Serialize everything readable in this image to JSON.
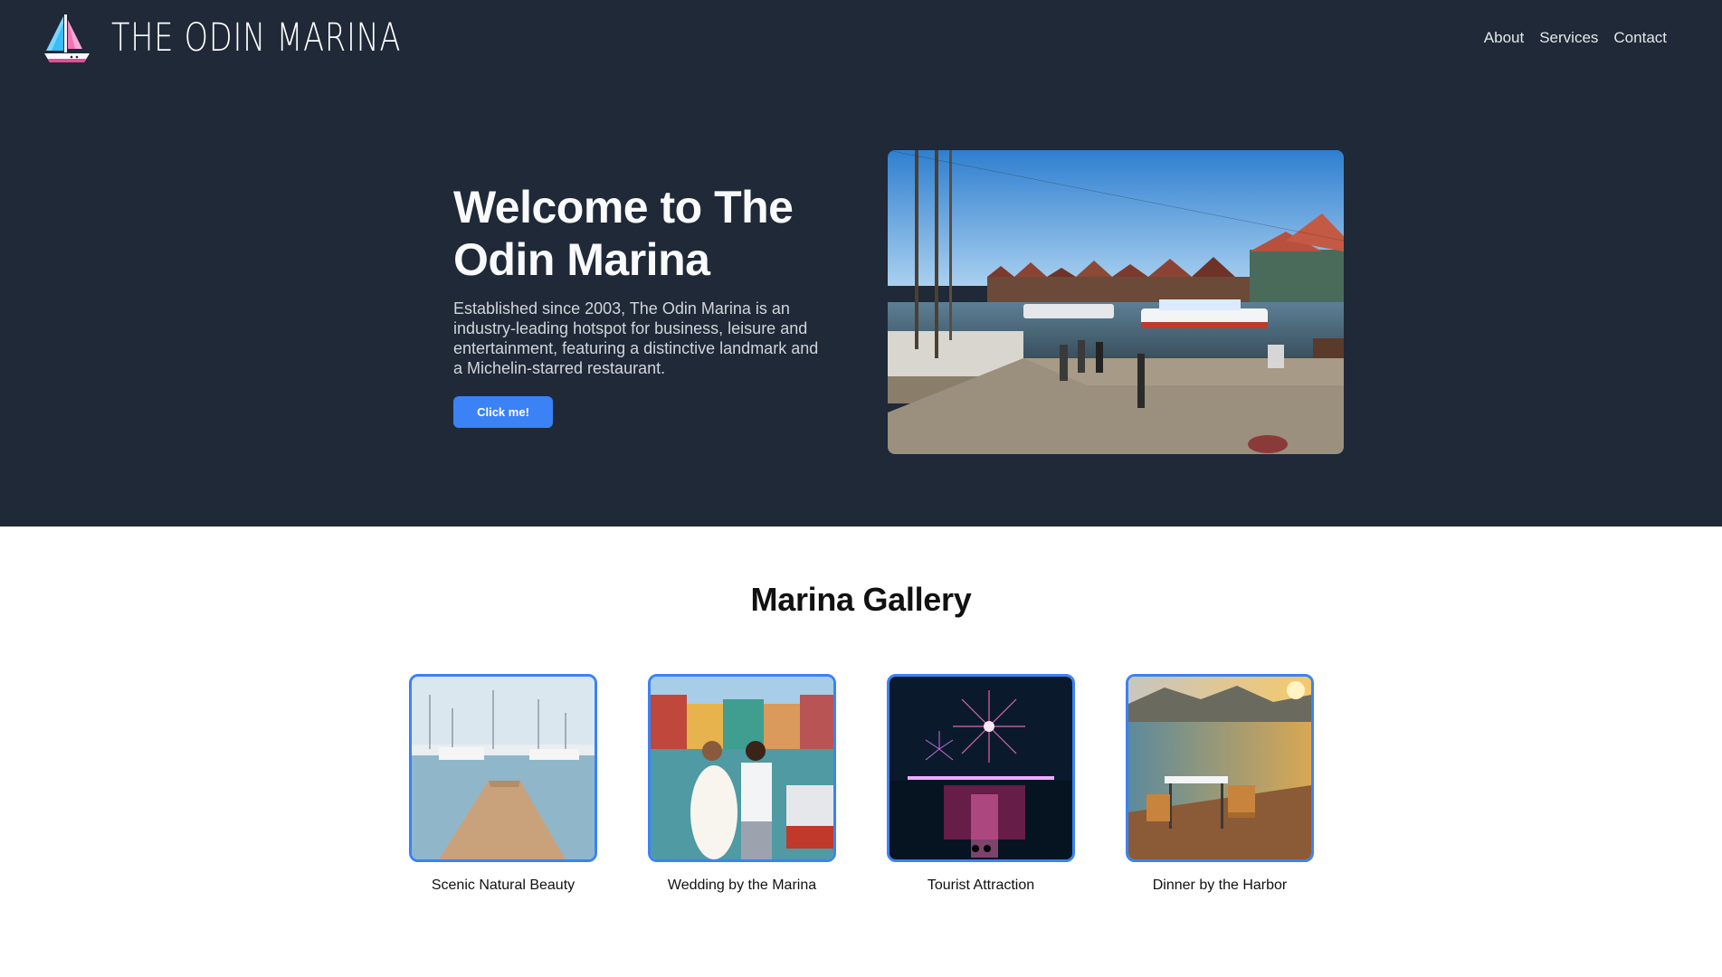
{
  "brand": {
    "name": "THE ODIN MARINA",
    "logo_icon": "sailboat-icon"
  },
  "nav": {
    "items": [
      {
        "label": "About"
      },
      {
        "label": "Services"
      },
      {
        "label": "Contact"
      }
    ]
  },
  "hero": {
    "title": "Welcome to The Odin Marina",
    "description": "Established since 2003, The Odin Marina is an industry-leading hotspot for business, leisure and entertainment, featuring a distinctive landmark and a Michelin-starred restaurant.",
    "button_label": "Click me!",
    "image_alt": "Harbor with boats and waterfront houses"
  },
  "gallery": {
    "title": "Marina Gallery",
    "items": [
      {
        "caption": "Scenic Natural Beauty"
      },
      {
        "caption": "Wedding by the Marina"
      },
      {
        "caption": "Tourist Attraction"
      },
      {
        "caption": "Dinner by the Harbor"
      }
    ]
  },
  "colors": {
    "header_bg": "#1f2937",
    "accent": "#3b82f6",
    "page_bg": "#ffffff"
  }
}
